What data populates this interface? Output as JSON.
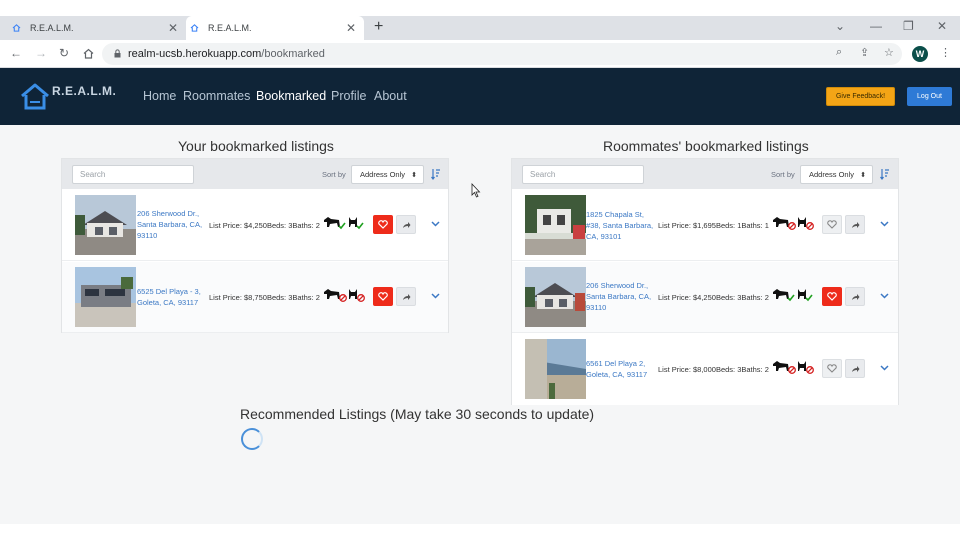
{
  "browser": {
    "tabs": [
      {
        "title": "R.E.A.L.M.",
        "active": false
      },
      {
        "title": "R.E.A.L.M.",
        "active": true
      }
    ],
    "url_host": "realm-ucsb.herokuapp.com",
    "url_path": "/bookmarked",
    "profile_initial": "W"
  },
  "nav": {
    "brand": "R.E.A.L.M.",
    "links": [
      "Home",
      "Roommates",
      "Bookmarked",
      "Profile",
      "About"
    ],
    "active": "Bookmarked",
    "feedback_label": "Give Feedback!",
    "logout_label": "Log Out"
  },
  "colors": {
    "navbar": "#0f2437",
    "feedback": "#f4a516",
    "logout": "#2e7ad6",
    "heart_active": "#ee2b1a",
    "link": "#3b78c4"
  },
  "your_bookmarks": {
    "title": "Your bookmarked listings",
    "search_placeholder": "Search",
    "sort_label": "Sort by",
    "sort_value": "Address Only",
    "listings": [
      {
        "address": "206 Sherwood Dr., Santa Barbara, CA, 93110",
        "details": "List Price: $4,250Beds: 3Baths: 2",
        "dog": "allowed",
        "cat": "allowed",
        "bookmarked": true
      },
      {
        "address": "6525 Del Playa - 3, Goleta, CA, 93117",
        "details": "List Price: $8,750Beds: 3Baths: 2",
        "dog": "not-allowed",
        "cat": "not-allowed",
        "bookmarked": true
      }
    ]
  },
  "roommate_bookmarks": {
    "title": "Roommates' bookmarked listings",
    "search_placeholder": "Search",
    "sort_label": "Sort by",
    "sort_value": "Address Only",
    "listings": [
      {
        "address": "1825 Chapala St, #38, Santa Barbara, CA, 93101",
        "details": "List Price: $1,695Beds: 1Baths: 1",
        "dog": "not-allowed",
        "cat": "not-allowed",
        "bookmarked": false
      },
      {
        "address": "206 Sherwood Dr., Santa Barbara, CA, 93110",
        "details": "List Price: $4,250Beds: 3Baths: 2",
        "dog": "allowed",
        "cat": "allowed",
        "bookmarked": true
      },
      {
        "address": "6561 Del Playa 2, Goleta, CA, 93117",
        "details": "List Price: $8,000Beds: 3Baths: 2",
        "dog": "not-allowed",
        "cat": "not-allowed",
        "bookmarked": false
      }
    ]
  },
  "recommended": {
    "title": "Recommended Listings (May take 30 seconds to update)"
  }
}
